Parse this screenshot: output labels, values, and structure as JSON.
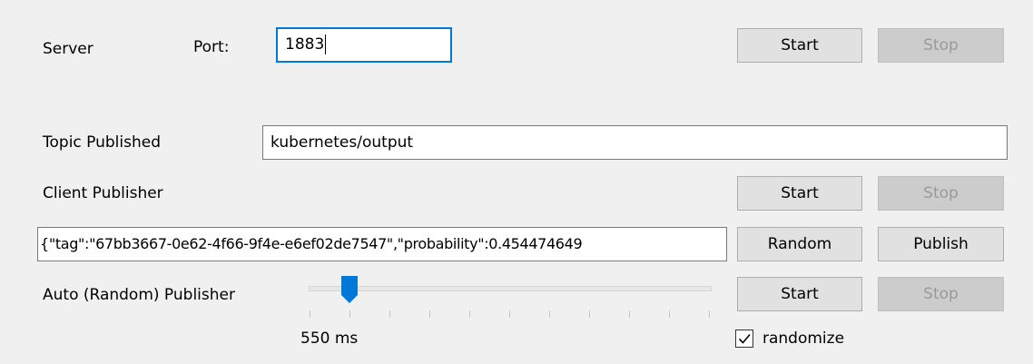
{
  "server": {
    "label": "Server",
    "port_label": "Port:",
    "port_value": "1883",
    "start_label": "Start",
    "stop_label": "Stop"
  },
  "topic": {
    "label": "Topic Published",
    "value": "kubernetes/output"
  },
  "client_publisher": {
    "label": "Client Publisher",
    "start_label": "Start",
    "stop_label": "Stop",
    "message_value": "{\"tag\":\"67bb3667-0e62-4f66-9f4e-e6ef02de7547\",\"probability\":0.454474649",
    "random_label": "Random",
    "publish_label": "Publish"
  },
  "auto_publisher": {
    "label": "Auto (Random) Publisher",
    "interval_text": "550 ms",
    "slider_position_index": 1,
    "slider_tick_count": 11,
    "start_label": "Start",
    "stop_label": "Stop",
    "randomize_label": "randomize",
    "randomize_checked": true
  },
  "colors": {
    "focus_border": "#0078d7",
    "slider_thumb": "#0078d7"
  }
}
